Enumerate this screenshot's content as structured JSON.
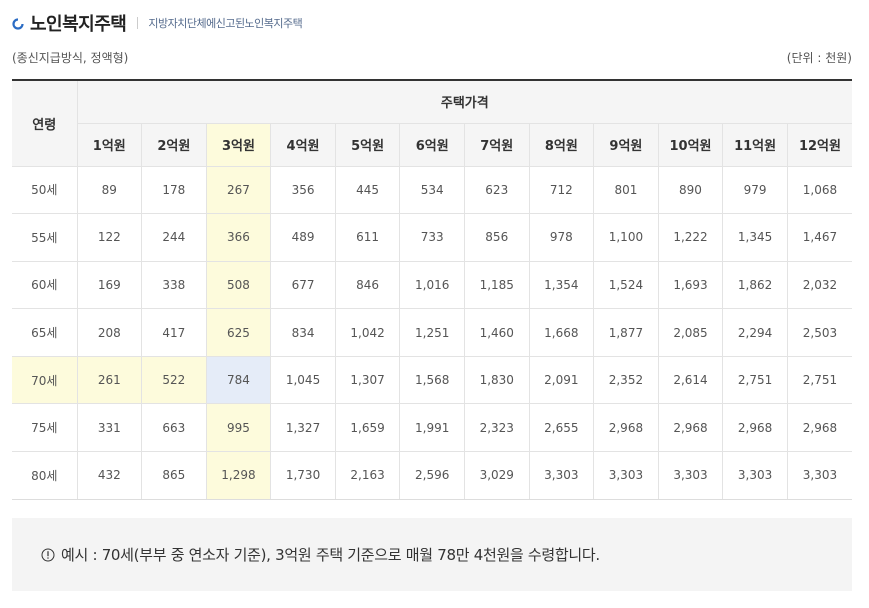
{
  "header": {
    "title": "노인복지주택",
    "subtitle": "지방자치단체에신고된노인복지주택"
  },
  "meta": {
    "method": "(종신지급방식, 정액형)",
    "unit": "(단위 : 천원)"
  },
  "table": {
    "age_header": "연령",
    "price_group_header": "주택가격",
    "price_headers": [
      "1억원",
      "2억원",
      "3억원",
      "4억원",
      "5억원",
      "6억원",
      "7억원",
      "8억원",
      "9억원",
      "10억원",
      "11억원",
      "12억원"
    ],
    "rows": [
      {
        "age": "50세",
        "values": [
          "89",
          "178",
          "267",
          "356",
          "445",
          "534",
          "623",
          "712",
          "801",
          "890",
          "979",
          "1,068"
        ]
      },
      {
        "age": "55세",
        "values": [
          "122",
          "244",
          "366",
          "489",
          "611",
          "733",
          "856",
          "978",
          "1,100",
          "1,222",
          "1,345",
          "1,467"
        ]
      },
      {
        "age": "60세",
        "values": [
          "169",
          "338",
          "508",
          "677",
          "846",
          "1,016",
          "1,185",
          "1,354",
          "1,524",
          "1,693",
          "1,862",
          "2,032"
        ]
      },
      {
        "age": "65세",
        "values": [
          "208",
          "417",
          "625",
          "834",
          "1,042",
          "1,251",
          "1,460",
          "1,668",
          "1,877",
          "2,085",
          "2,294",
          "2,503"
        ]
      },
      {
        "age": "70세",
        "values": [
          "261",
          "522",
          "784",
          "1,045",
          "1,307",
          "1,568",
          "1,830",
          "2,091",
          "2,352",
          "2,614",
          "2,751",
          "2,751"
        ]
      },
      {
        "age": "75세",
        "values": [
          "331",
          "663",
          "995",
          "1,327",
          "1,659",
          "1,991",
          "2,323",
          "2,655",
          "2,968",
          "2,968",
          "2,968",
          "2,968"
        ]
      },
      {
        "age": "80세",
        "values": [
          "432",
          "865",
          "1,298",
          "1,730",
          "2,163",
          "2,596",
          "3,029",
          "3,303",
          "3,303",
          "3,303",
          "3,303",
          "3,303"
        ]
      }
    ],
    "highlight_column": "3억원",
    "highlight_row": "70세"
  },
  "note": {
    "icon": "info-circle-icon",
    "text": "예시 : 70세(부부 중 연소자 기준), 3억원 주택 기준으로 매월 78만 4천원을 수령합니다."
  },
  "colors": {
    "highlight_yellow": "#fdfbdc",
    "highlight_blue": "#e5ecf8",
    "header_bg": "#f5f5f5",
    "note_bg": "#f4f4f4",
    "bullet_blue": "#2b6cc4"
  }
}
